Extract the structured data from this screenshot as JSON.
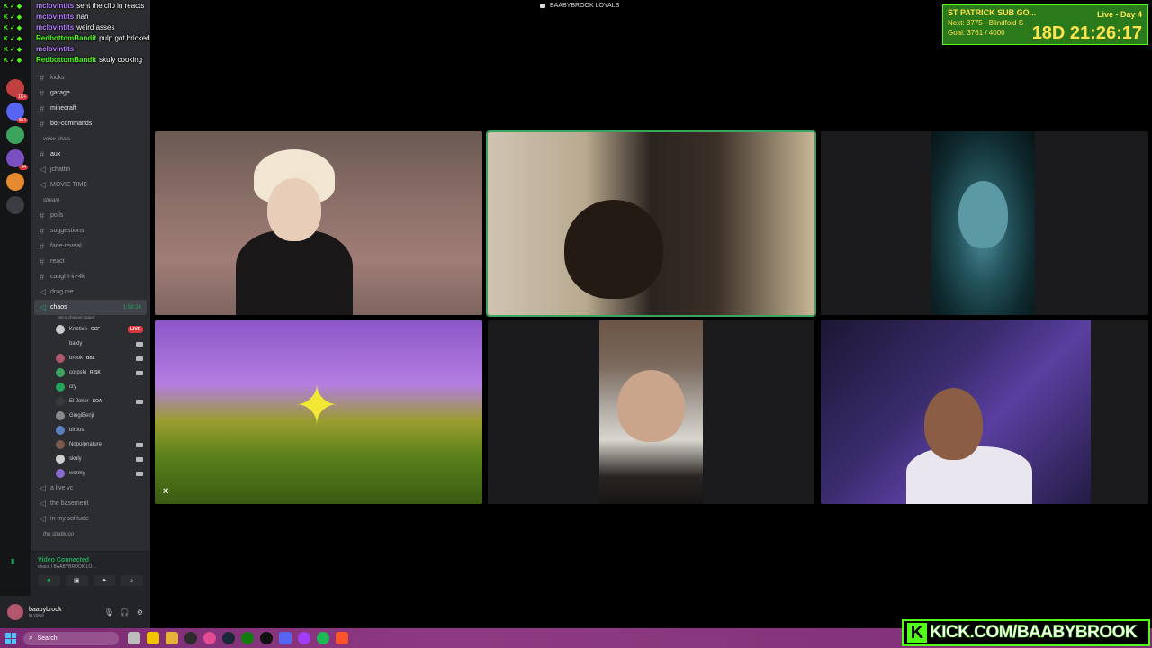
{
  "stream_title": "BAABYBROOK LOYALS",
  "chat": [
    {
      "user": "mclovintits",
      "color": "#b57cff",
      "msg": "sent the clip in reacts"
    },
    {
      "user": "mclovintits",
      "color": "#b57cff",
      "msg": "nah"
    },
    {
      "user": "mclovintits",
      "color": "#b57cff",
      "msg": "weird asses"
    },
    {
      "user": "RedbottomBandit",
      "color": "#53fc18",
      "msg": "pulp got bricked"
    },
    {
      "user": "mclovintits",
      "color": "#b57cff",
      "msg": ""
    },
    {
      "user": "RedbottomBandit",
      "color": "#53fc18",
      "msg": "skuly cooking"
    }
  ],
  "channels": {
    "text_top": [
      {
        "label": "kicks"
      },
      {
        "label": "garage"
      },
      {
        "label": "minecraft"
      },
      {
        "label": "bot-commands"
      }
    ],
    "voice_category": "voice chats",
    "voice_top": [
      {
        "label": "aux",
        "kind": "text"
      },
      {
        "label": "jchattin",
        "kind": "voice"
      },
      {
        "label": "MOVIE TIME",
        "kind": "voice"
      }
    ],
    "stream_category": "stream",
    "stream_items": [
      {
        "label": "polls",
        "kind": "text"
      },
      {
        "label": "suggestions",
        "kind": "text"
      },
      {
        "label": "face-reveal",
        "kind": "text"
      },
      {
        "label": "react",
        "kind": "text"
      },
      {
        "label": "caught-in-4k",
        "kind": "text"
      },
      {
        "label": "drag me",
        "kind": "voice"
      }
    ],
    "active_vc": {
      "label": "chaos",
      "timer": "1:58:24",
      "status": "Set a channel status"
    },
    "vc_users": [
      {
        "name": "Knotixe",
        "tag": "CCF",
        "live": "LIVE",
        "av": "#c9c9c9"
      },
      {
        "name": "baldy",
        "tag": "",
        "live": "",
        "av": "#2d2d2d"
      },
      {
        "name": "brook",
        "tag": "BBL",
        "live": "",
        "av": "#b0566d"
      },
      {
        "name": "corpski",
        "tag": "RISK",
        "live": "",
        "av": "#3ba55d"
      },
      {
        "name": "cry",
        "tag": "",
        "live": "",
        "av": "#23a55a"
      },
      {
        "name": "El Joker",
        "tag": "KOA",
        "live": "",
        "av": "#3a3a3a"
      },
      {
        "name": "GingiBenji",
        "tag": "",
        "live": "",
        "av": "#888"
      },
      {
        "name": "birbos",
        "tag": "",
        "live": "",
        "av": "#5a7fbf"
      },
      {
        "name": "Nopulpnature",
        "tag": "",
        "live": "",
        "av": "#7a5a4a"
      },
      {
        "name": "skuly",
        "tag": "",
        "live": "",
        "av": "#d0d0d0"
      },
      {
        "name": "wormy",
        "tag": "",
        "live": "",
        "av": "#8a6ad0"
      }
    ],
    "voice_bottom": [
      {
        "label": "a live vc"
      },
      {
        "label": "the basement"
      },
      {
        "label": "in my solitude"
      }
    ],
    "bottom_category": "the studiiooo"
  },
  "voice_panel": {
    "title": "Video Connected",
    "sub": "chaos / BAABYBROOK LO..."
  },
  "user_panel": {
    "name": "baabybrook",
    "status": "in voice"
  },
  "subgoal": {
    "title": "ST PATRICK SUB GO...",
    "next": "Next: 3775 - Blindfold S",
    "goal": "Goal: 3761 / 4000",
    "live": "Live - Day 4",
    "timer": "18D 21:26:17"
  },
  "guild_badges": [
    "1K+",
    "803",
    "94"
  ],
  "taskbar": {
    "search_placeholder": "Search"
  },
  "kick_banner": "KICK.COM/BAABYBROOK",
  "colors": {
    "kick_green": "#53fc18",
    "discord_bg": "#2b2d31",
    "speaking": "#3ba55d"
  }
}
